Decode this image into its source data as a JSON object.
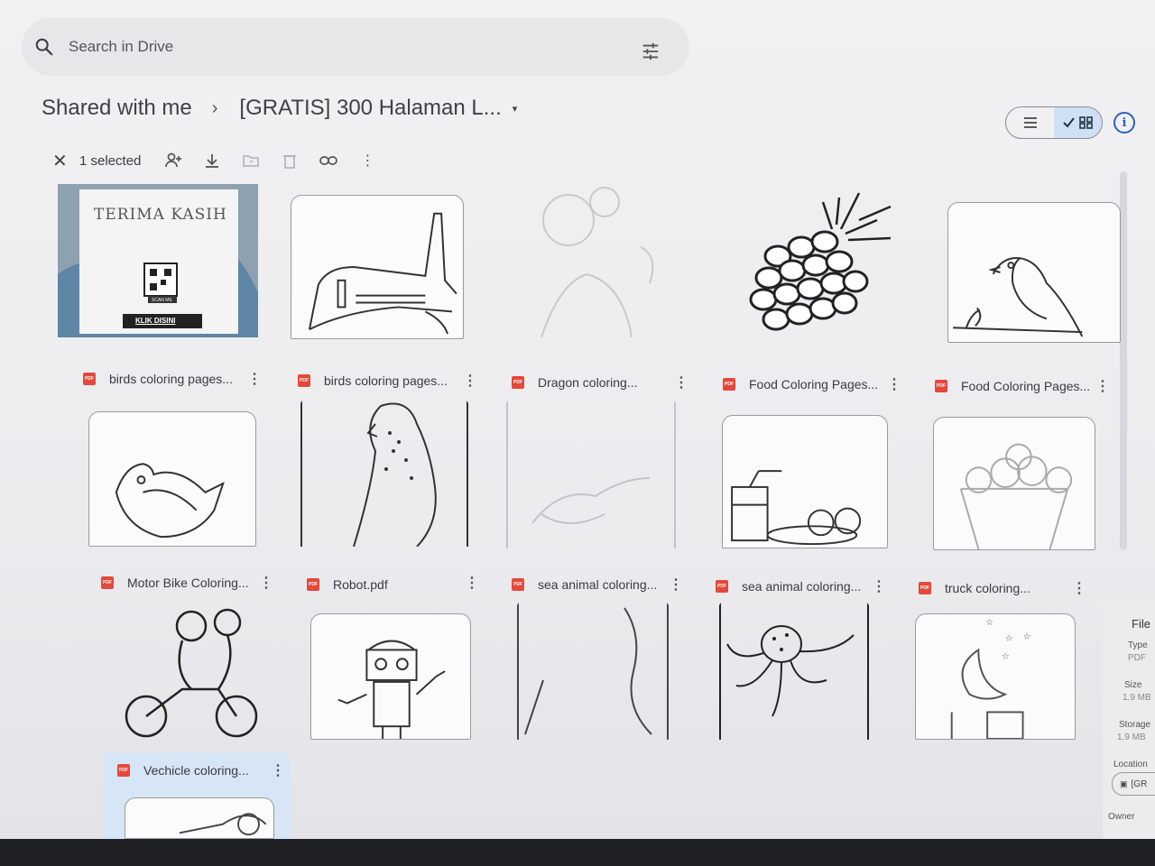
{
  "search": {
    "placeholder": "Search in Drive"
  },
  "breadcrumb": {
    "root": "Shared with me",
    "separator": "›",
    "current": "[GRATIS] 300 Halaman L...",
    "caret": "▾"
  },
  "selection": {
    "count_label": "1 selected"
  },
  "files": [
    {
      "name": "birds coloring pages..."
    },
    {
      "name": "birds coloring pages..."
    },
    {
      "name": "Dragon coloring..."
    },
    {
      "name": "Food Coloring Pages..."
    },
    {
      "name": "Food Coloring Pages..."
    },
    {
      "name": "Motor Bike Coloring..."
    },
    {
      "name": "Robot.pdf"
    },
    {
      "name": "sea animal coloring..."
    },
    {
      "name": "sea animal coloring..."
    },
    {
      "name": "truck coloring..."
    },
    {
      "name": "Vechicle coloring..."
    }
  ],
  "thumbnails": {
    "terima_kasih": "TERIMA KASIH",
    "scan_me": "SCAN ME",
    "klik_disini": "KLIK DISINI"
  },
  "pdf_badge": "PDF",
  "details": {
    "title": "File",
    "type_label": "Type",
    "type_value": "PDF",
    "size_label": "Size",
    "size_value": "1.9 MB",
    "storage_label": "Storage",
    "storage_value": "1.9 MB",
    "location_label": "Location",
    "location_value": "[GR",
    "owner_label": "Owner"
  },
  "colors": {
    "accent": "#2d62b8",
    "selected_bg": "#d7e6f6",
    "pdf_red": "#e5483a"
  }
}
